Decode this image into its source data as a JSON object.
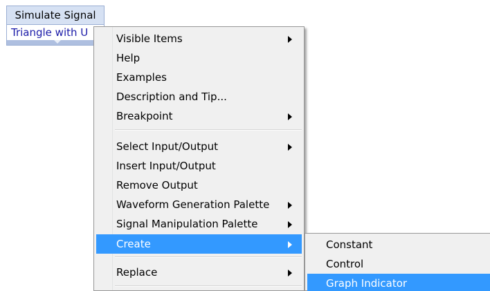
{
  "vi_node": {
    "title": "Simulate Signal",
    "parameter": "Triangle with U"
  },
  "context_menu": {
    "items": [
      {
        "label": "Visible Items",
        "has_submenu": true
      },
      {
        "label": "Help",
        "has_submenu": false
      },
      {
        "label": "Examples",
        "has_submenu": false
      },
      {
        "label": "Description and Tip...",
        "has_submenu": false
      },
      {
        "label": "Breakpoint",
        "has_submenu": true
      },
      {
        "label": "Select Input/Output",
        "has_submenu": true
      },
      {
        "label": "Insert Input/Output",
        "has_submenu": false
      },
      {
        "label": "Remove Output",
        "has_submenu": false
      },
      {
        "label": "Waveform Generation Palette",
        "has_submenu": true
      },
      {
        "label": "Signal Manipulation Palette",
        "has_submenu": true
      },
      {
        "label": "Create",
        "has_submenu": true,
        "highlighted": true
      },
      {
        "label": "Replace",
        "has_submenu": true
      }
    ]
  },
  "create_submenu": {
    "items": [
      {
        "label": "Constant"
      },
      {
        "label": "Control"
      },
      {
        "label": "Graph Indicator",
        "highlighted": true
      }
    ]
  },
  "colors": {
    "highlight": "#3399ff",
    "menu_background": "#f0f0f0",
    "node_background": "#d6e1f3",
    "parameter_text": "#1a1aa8"
  }
}
